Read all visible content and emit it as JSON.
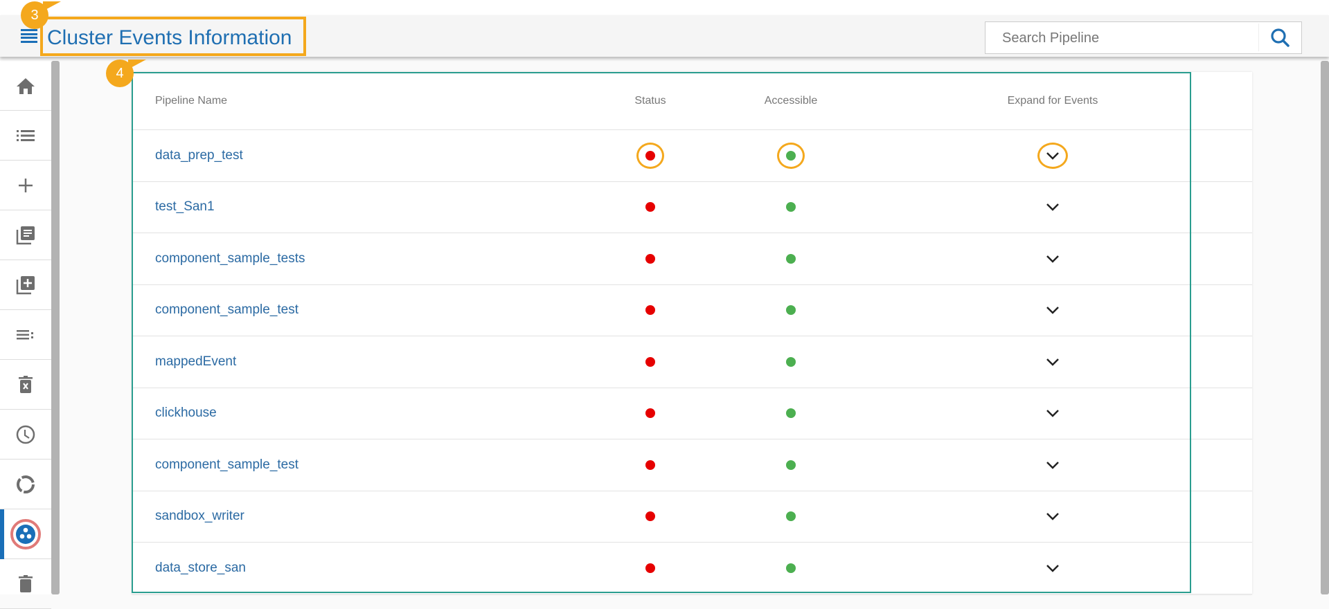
{
  "header": {
    "title": "Cluster Events Information",
    "search_placeholder": "Search Pipeline"
  },
  "annotations": [
    "3",
    "4"
  ],
  "sidebar": {
    "items": [
      "home-icon",
      "list-icon",
      "add-icon",
      "library-icon",
      "library-add-icon",
      "playlist-icon",
      "delete-x-icon",
      "clock-icon",
      "donut-icon",
      "cluster-icon",
      "trash-icon"
    ],
    "active": 9
  },
  "table": {
    "columns": [
      "Pipeline Name",
      "Status",
      "Accessible",
      "Expand for Events"
    ],
    "rows": [
      {
        "name": "data_prep_test",
        "status": "error",
        "accessible": "yes"
      },
      {
        "name": "test_San1",
        "status": "error",
        "accessible": "yes"
      },
      {
        "name": "component_sample_tests",
        "status": "error",
        "accessible": "yes"
      },
      {
        "name": "component_sample_test",
        "status": "error",
        "accessible": "yes"
      },
      {
        "name": "mappedEvent",
        "status": "error",
        "accessible": "yes"
      },
      {
        "name": "clickhouse",
        "status": "error",
        "accessible": "yes"
      },
      {
        "name": "component_sample_test",
        "status": "error",
        "accessible": "yes"
      },
      {
        "name": "sandbox_writer",
        "status": "error",
        "accessible": "yes"
      },
      {
        "name": "data_store_san",
        "status": "error",
        "accessible": "yes"
      }
    ]
  },
  "colors": {
    "accent": "#1f6fb2",
    "status_red": "#e60000",
    "status_green": "#4caf50",
    "highlight": "#f4a81d",
    "frame": "#2a9d8f"
  }
}
